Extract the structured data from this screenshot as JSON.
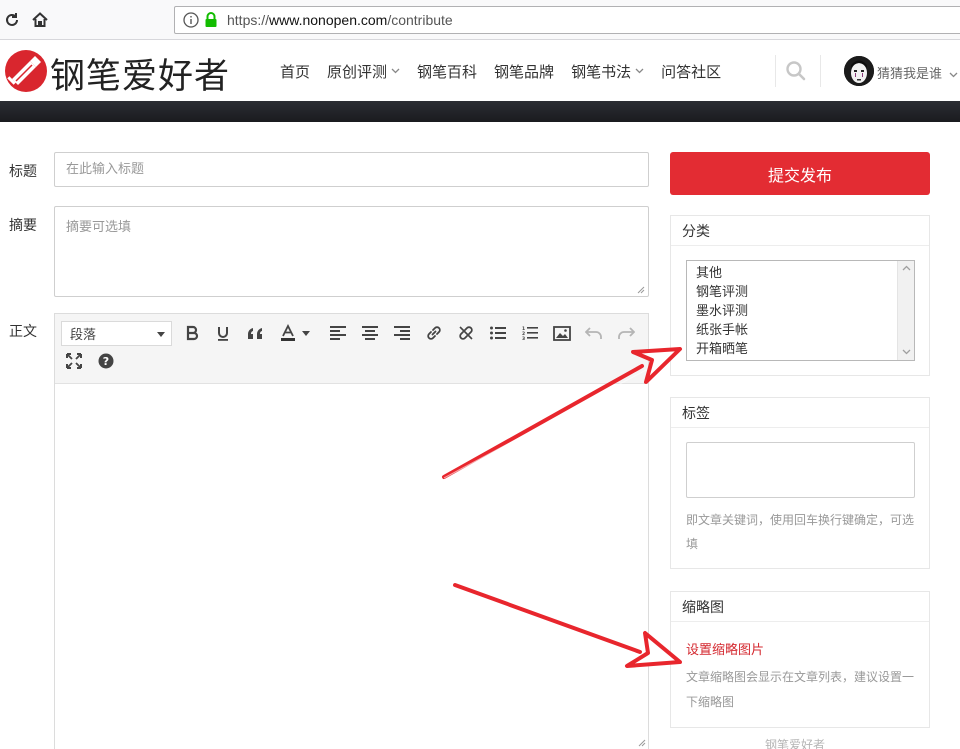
{
  "browser": {
    "url_host": "www.nonopen.com",
    "url_scheme": "https://",
    "url_path": "/contribute"
  },
  "site": {
    "logo_text": "钢笔爱好者",
    "nav": [
      "首页",
      "原创评测",
      "钢笔百科",
      "钢笔品牌",
      "钢笔书法",
      "问答社区"
    ],
    "user_name": "猜猜我是谁",
    "colors": {
      "accent": "#e32c33",
      "dark_band": "#22242a"
    }
  },
  "form": {
    "title_label": "标题",
    "title_placeholder": "在此输入标题",
    "summary_label": "摘要",
    "summary_placeholder": "摘要可选填",
    "body_label": "正文",
    "format_value": "段落"
  },
  "sidebar": {
    "submit_label": "提交发布",
    "category": {
      "heading": "分类",
      "options": [
        "其他",
        "钢笔评测",
        "墨水评测",
        "纸张手帐",
        "开箱晒笔"
      ]
    },
    "tags": {
      "heading": "标签",
      "help": "即文章关键词，使用回车换行键确定，可选填"
    },
    "thumbnail": {
      "heading": "缩略图",
      "link": "设置缩略图片",
      "help": "文章缩略图会显示在文章列表，建议设置一下缩略图"
    }
  },
  "watermark": "钢笔爱好者"
}
